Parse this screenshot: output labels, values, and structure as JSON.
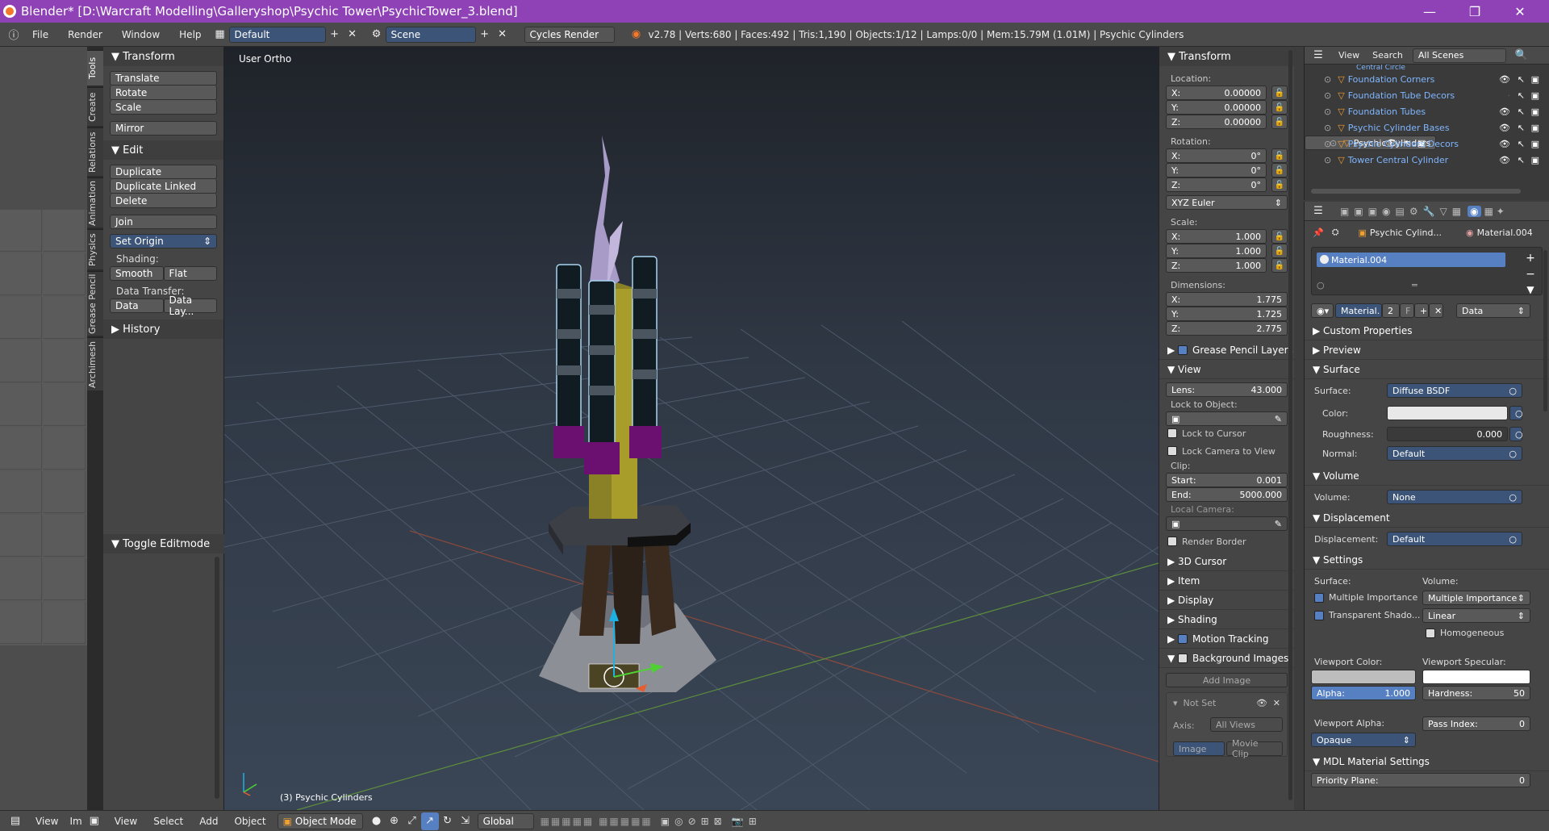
{
  "window": {
    "title": "Blender* [D:\\Warcraft Modelling\\Galleryshop\\Psychic Tower\\PsychicTower_3.blend]",
    "minimize": "—",
    "maximize": "❐",
    "close": "✕",
    "accent": "#8e42b5"
  },
  "infobar": {
    "menus": [
      "File",
      "Render",
      "Window",
      "Help"
    ],
    "layout": "Default",
    "scene": "Scene",
    "engine": "Cycles Render",
    "stats": "v2.78 | Verts:680 | Faces:492 | Tris:1,190 | Objects:1/12 | Lamps:0/0 | Mem:15.79M (1.01M) | Psychic Cylinders"
  },
  "lefttabs": [
    "Tools",
    "Create",
    "Relations",
    "Animation",
    "Physics",
    "Grease Pencil",
    "Archimesh"
  ],
  "toolshelf": {
    "transform_header": "Transform",
    "transform_buttons": [
      "Translate",
      "Rotate",
      "Scale",
      "Mirror"
    ],
    "edit_header": "Edit",
    "edit_buttons": [
      "Duplicate",
      "Duplicate Linked",
      "Delete"
    ],
    "join": "Join",
    "set_origin": "Set Origin",
    "shading_label": "Shading:",
    "smooth": "Smooth",
    "flat": "Flat",
    "data_transfer_label": "Data Transfer:",
    "data": "Data",
    "data_layers": "Data Lay...",
    "history": "History",
    "toggle_editmode": "Toggle Editmode"
  },
  "viewport": {
    "view_name": "User Ortho",
    "object_label": "(3) Psychic Cylinders"
  },
  "npanel": {
    "transform": "Transform",
    "location_label": "Location:",
    "location": [
      "0.00000",
      "0.00000",
      "0.00000"
    ],
    "rotation_label": "Rotation:",
    "rotation": [
      "0°",
      "0°",
      "0°"
    ],
    "rotation_mode": "XYZ Euler",
    "scale_label": "Scale:",
    "scale": [
      "1.000",
      "1.000",
      "1.000"
    ],
    "dimensions_label": "Dimensions:",
    "dimensions": [
      "1.775",
      "1.725",
      "2.775"
    ],
    "axes": [
      "X:",
      "Y:",
      "Z:"
    ],
    "grease_pencil": "Grease Pencil Layers",
    "view": "View",
    "lens_label": "Lens:",
    "lens": "43.000",
    "lock_to_object": "Lock to Object:",
    "lock_to_cursor": "Lock to Cursor",
    "lock_camera": "Lock Camera to View",
    "clip_label": "Clip:",
    "start_label": "Start:",
    "start": "0.001",
    "end_label": "End:",
    "end": "5000.000",
    "local_camera": "Local Camera:",
    "render_border": "Render Border",
    "collapsed": [
      "3D Cursor",
      "Item",
      "Display",
      "Shading"
    ],
    "motion_tracking": "Motion Tracking",
    "background_images": "Background Images",
    "add_image": "Add Image",
    "not_set": "Not Set",
    "axis_label": "Axis:",
    "axis": "All Views",
    "image_tab": "Image",
    "movie_clip_tab": "Movie Clip"
  },
  "outliner": {
    "view": "View",
    "search": "Search",
    "scenes": "All Scenes",
    "partial_top": "Central Circle",
    "items": [
      "Foundation Corners",
      "Foundation Tube Decors",
      "Foundation Tubes",
      "Psychic Cylinder Bases",
      "Psychic Cylinders",
      "Psychic Cylinders Decors",
      "Tower Central Cylinder"
    ],
    "selected_index": 4
  },
  "props": {
    "object": "Psychic Cylind...",
    "material": "Material.004",
    "slot": "Material.004",
    "mat_name": "Material.",
    "users": "2",
    "fake_user": "F",
    "link": "Data",
    "custom_props": "Custom Properties",
    "preview": "Preview",
    "surface": "Surface",
    "surface_label": "Surface:",
    "surface_value": "Diffuse BSDF",
    "color_label": "Color:",
    "roughness_label": "Roughness:",
    "roughness": "0.000",
    "normal_label": "Normal:",
    "normal": "Default",
    "volume": "Volume",
    "volume_label": "Volume:",
    "volume_value": "None",
    "displacement": "Displacement",
    "displacement_label": "Displacement:",
    "displacement_value": "Default",
    "settings": "Settings",
    "settings_surface": "Surface:",
    "settings_volume": "Volume:",
    "multiple_importance": "Multiple Importance",
    "multiple_importance_sel": "Multiple Importance",
    "transparent_shadows": "Transparent Shado...",
    "linear": "Linear",
    "homogeneous": "Homogeneous",
    "viewport_color": "Viewport Color:",
    "viewport_specular": "Viewport Specular:",
    "alpha_label": "Alpha:",
    "alpha": "1.000",
    "hardness_label": "Hardness:",
    "hardness": "50",
    "viewport_alpha": "Viewport Alpha:",
    "pass_index_label": "Pass Index:",
    "pass_index": "0",
    "opaque": "Opaque",
    "mdl": "MDL Material Settings",
    "priority_plane_label": "Priority Plane:",
    "priority_plane": "0"
  },
  "bottombar": {
    "view": "View",
    "view2": "View",
    "select": "Select",
    "add": "Add",
    "object": "Object",
    "mode": "Object Mode",
    "orientation": "Global",
    "partial": "Im"
  }
}
